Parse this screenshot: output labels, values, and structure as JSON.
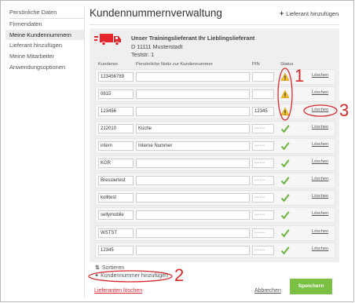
{
  "sidebar": {
    "items": [
      {
        "label": "Persönliche Daten",
        "active": false
      },
      {
        "label": "Firmendaten",
        "active": false
      },
      {
        "label": "Meine Kundennummern",
        "active": true
      },
      {
        "label": "Lieferant hinzufügen",
        "active": false
      },
      {
        "label": "Meine Mitarbeiter",
        "active": false
      },
      {
        "label": "Anwendungsoptionen",
        "active": false
      }
    ]
  },
  "header": {
    "title": "Kundennummernverwaltung",
    "add_supplier_label": "Lieferant hinzufügen"
  },
  "supplier": {
    "name": "Unser Trainingslieferant Ihr Lieblingslieferant",
    "city": "D 11111 Musterstadt",
    "street": "Teststr. 1",
    "logo_icon": "truck-icon",
    "logo_color": "#e3262b"
  },
  "table": {
    "headers": {
      "number": "Kundennr.",
      "note": "Persönliche Notiz zur Kundennummer",
      "pin": "PIN",
      "status": "Status"
    },
    "rows": [
      {
        "number": "123456789",
        "note": "",
        "pin": "",
        "status": "warning",
        "delete": "Löschen"
      },
      {
        "number": "0815",
        "note": "",
        "pin": "",
        "status": "warning",
        "delete": "Löschen"
      },
      {
        "number": "123456",
        "note": "",
        "pin": "12345",
        "status": "warning",
        "delete": "Löschen"
      },
      {
        "number": "212010",
        "note": "Küche",
        "pin": "••••••",
        "status": "ok",
        "delete": "Löschen"
      },
      {
        "number": "intern",
        "note": "Interne Nummer",
        "pin": "••••••",
        "status": "ok",
        "delete": "Löschen"
      },
      {
        "number": "KGR",
        "note": "",
        "pin": "••••••",
        "status": "ok",
        "delete": "Löschen"
      },
      {
        "number": "Bresslertest",
        "note": "",
        "pin": "••••••",
        "status": "ok",
        "delete": "Löschen"
      },
      {
        "number": "kollitest",
        "note": "",
        "pin": "••••••",
        "status": "ok",
        "delete": "Löschen"
      },
      {
        "number": "sellymobile",
        "note": "",
        "pin": "••••••",
        "status": "ok",
        "delete": "Löschen"
      },
      {
        "number": "WSTST",
        "note": "",
        "pin": "••••••",
        "status": "ok",
        "delete": "Löschen"
      },
      {
        "number": "12345",
        "note": "",
        "pin": "••••••",
        "status": "ok",
        "delete": "Löschen"
      }
    ]
  },
  "footer": {
    "sort_label": "Sortieren",
    "add_number_label": "Kundennummer hinzufügen",
    "delete_supplier_label": "Lieferanten löschen",
    "cancel_label": "Abbrechen",
    "save_label": "Speichern"
  },
  "annotations": {
    "marker_1": "1",
    "marker_2": "2",
    "marker_3": "3",
    "color": "#d62a2a"
  },
  "colors": {
    "accent_green": "#7ac143",
    "warning_yellow": "#f2c12e",
    "ok_green": "#6cb33f",
    "link_red": "#d9272e"
  }
}
